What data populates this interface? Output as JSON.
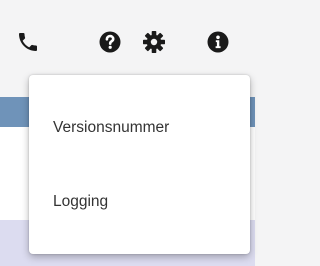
{
  "toolbar": {
    "icons": [
      "phone-icon",
      "help-circle-icon",
      "gear-icon",
      "info-circle-icon"
    ],
    "icon_color": "#1a1a1a"
  },
  "menu": {
    "items": [
      {
        "label": "Versionsnummer"
      },
      {
        "label": "Logging"
      }
    ]
  },
  "colors": {
    "background": "#f4f4f5",
    "header_strip": "#6f93b9",
    "row_highlight": "#dcdcf0",
    "menu_background": "#ffffff",
    "menu_text": "#333333"
  }
}
